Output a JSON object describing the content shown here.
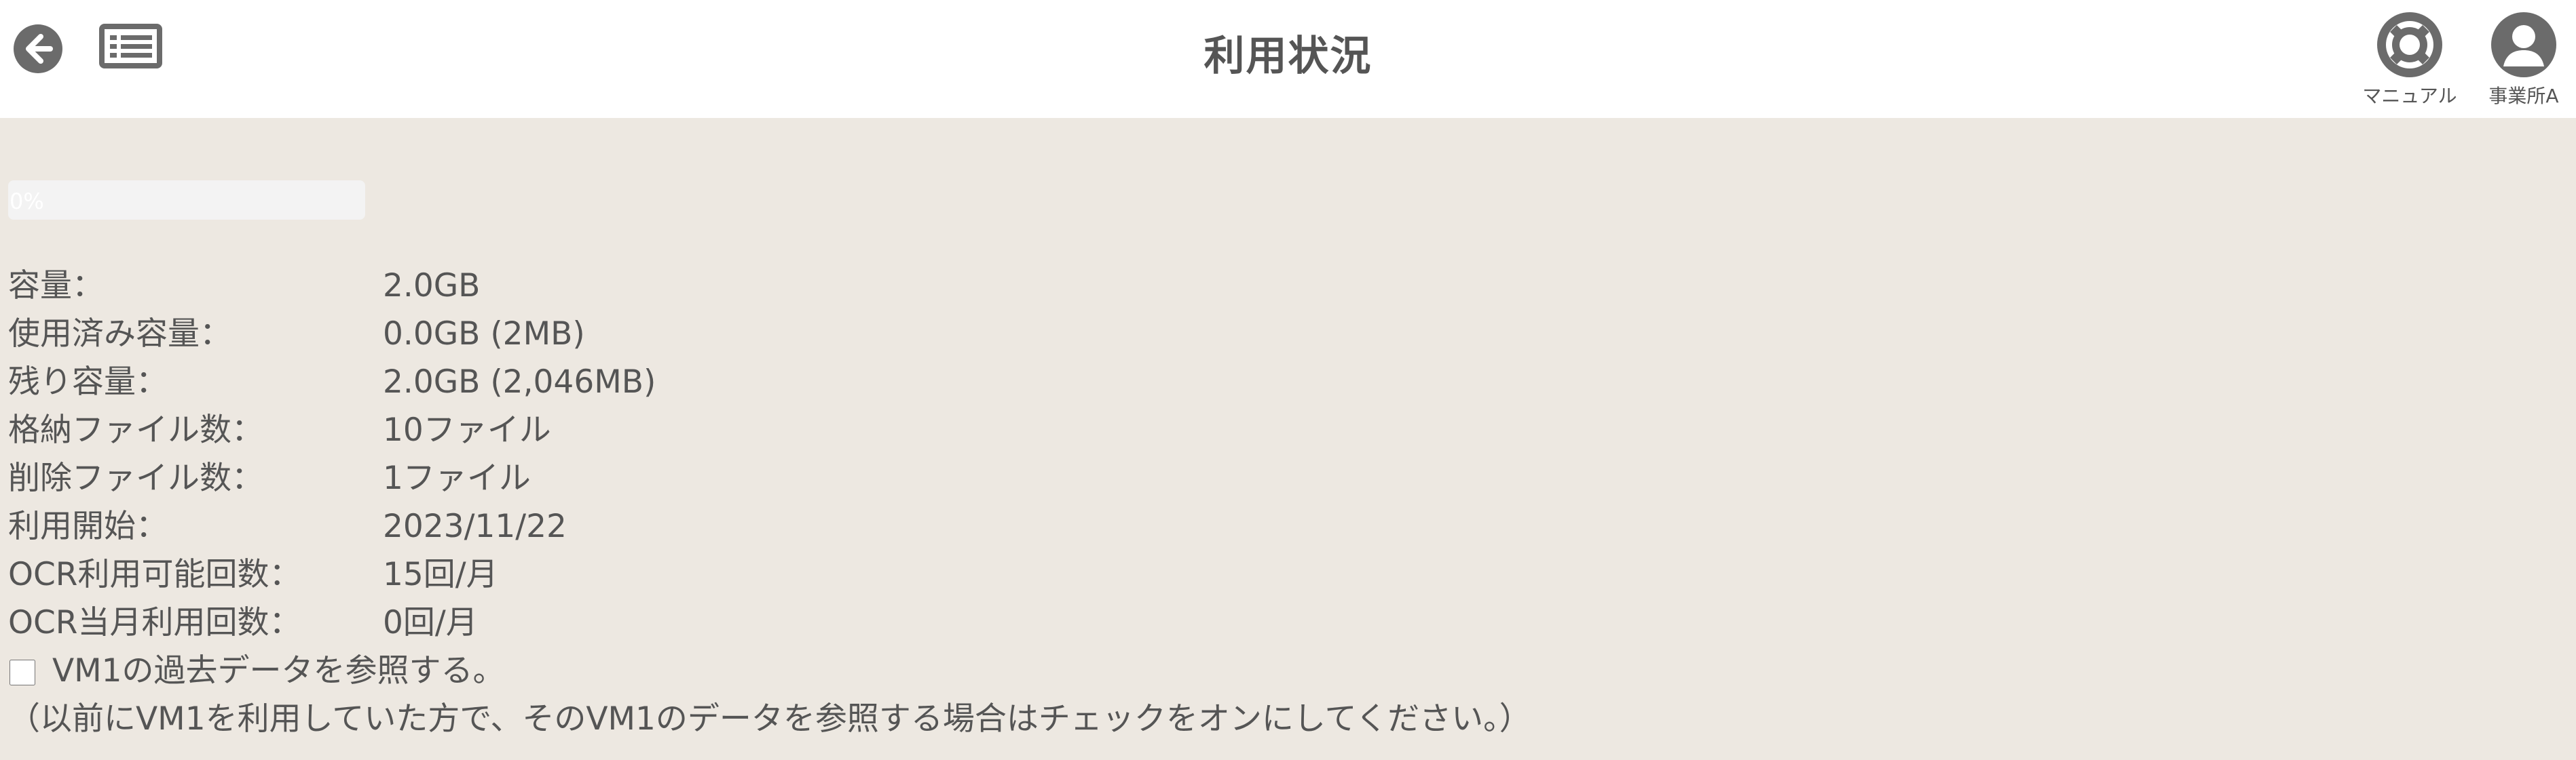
{
  "header": {
    "title": "利用状況",
    "manual_label": "マニュアル",
    "account_label": "事業所A"
  },
  "progress": {
    "percent": 0,
    "label": "0%"
  },
  "usage": {
    "rows": [
      {
        "label": "容量：",
        "value": "2.0GB"
      },
      {
        "label": "使用済み容量：",
        "value": "0.0GB (2MB)"
      },
      {
        "label": "残り容量：",
        "value": "2.0GB (2,046MB)"
      },
      {
        "label": "格納ファイル数：",
        "value": "10ファイル"
      },
      {
        "label": "削除ファイル数：",
        "value": "1ファイル"
      },
      {
        "label": "利用開始：",
        "value": "2023/11/22"
      },
      {
        "label": "OCR利用可能回数：",
        "value": "15回/月"
      },
      {
        "label": "OCR当月利用回数：",
        "value": "0回/月"
      }
    ]
  },
  "vm1": {
    "checkbox_label": "VM1の過去データを参照する。",
    "checked": false,
    "note": "（以前にVM1を利用していた方で、そのVM1のデータを参照する場合はチェックをオンにしてください。）"
  },
  "icons": {
    "back": "back-arrow-icon",
    "menu": "list-menu-icon",
    "manual": "lifebuoy-icon",
    "account": "user-icon"
  },
  "colors": {
    "header_bg": "#ffffff",
    "page_bg": "#ede8e1",
    "text": "#555555",
    "icon": "#6b6b6b"
  }
}
